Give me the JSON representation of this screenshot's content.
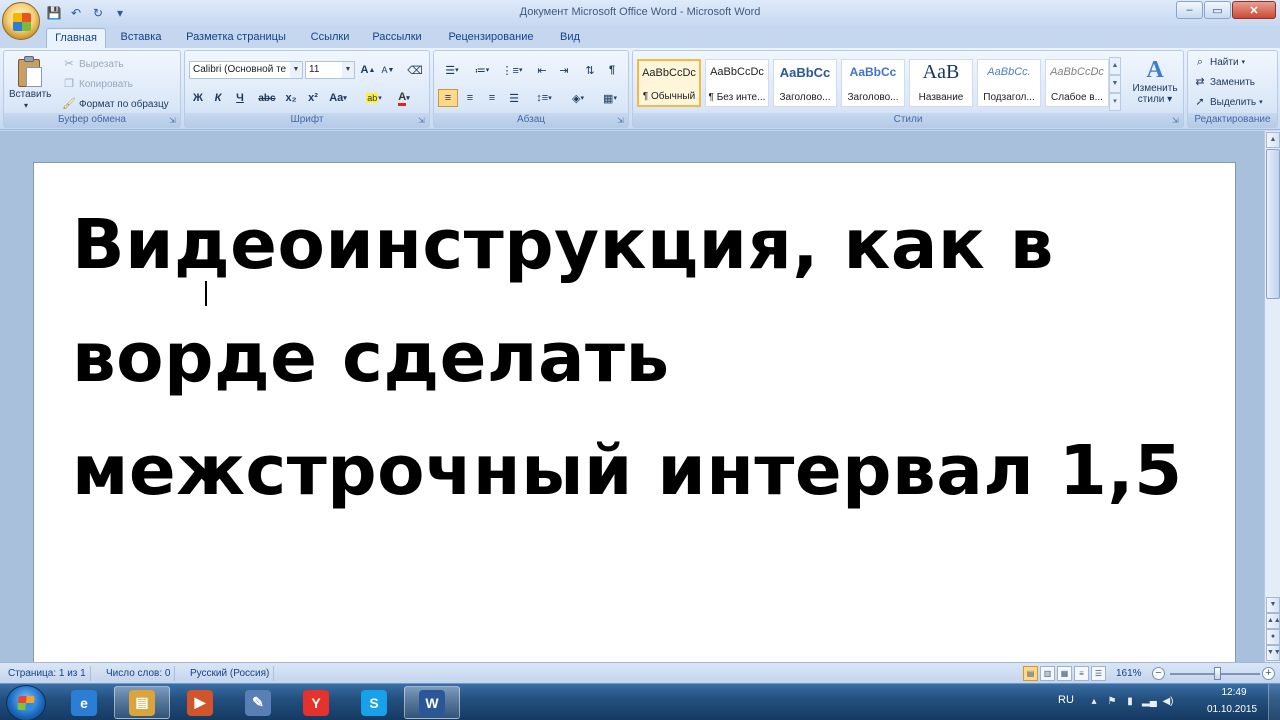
{
  "window": {
    "title": "Документ Microsoft Office Word - Microsoft Word",
    "controls": {
      "minimize": "–",
      "maximize": "▭",
      "close": "✕"
    }
  },
  "quick_access": {
    "save_icon": "💾",
    "undo_icon": "↶",
    "redo_icon": "↻",
    "customize_icon": "▾"
  },
  "tabs": [
    "Главная",
    "Вставка",
    "Разметка страницы",
    "Ссылки",
    "Рассылки",
    "Рецензирование",
    "Вид"
  ],
  "active_tab": "Главная",
  "ribbon": {
    "clipboard": {
      "label": "Буфер обмена",
      "paste": "Вставить",
      "cut": "Вырезать",
      "copy": "Копировать",
      "format_painter": "Формат по образцу"
    },
    "font": {
      "label": "Шрифт",
      "font_name": "Calibri (Основной те",
      "font_size": "11",
      "grow": "A",
      "shrink": "A",
      "clear": "⌫",
      "bold": "Ж",
      "italic": "К",
      "underline": "Ч",
      "strike": "abc",
      "subscript": "x₂",
      "superscript": "x²",
      "case": "Aa",
      "highlight": "ab",
      "color": "A"
    },
    "paragraph": {
      "label": "Абзац"
    },
    "styles": {
      "label": "Стили",
      "tiles": [
        {
          "sample": "AaBbCcDc",
          "name": "¶ Обычный",
          "active": true
        },
        {
          "sample": "AaBbCcDc",
          "name": "¶ Без инте..."
        },
        {
          "sample": "AaBbCc",
          "name": "Заголово..."
        },
        {
          "sample": "AaBbCc",
          "name": "Заголово..."
        },
        {
          "sample": "AaB",
          "name": "Название"
        },
        {
          "sample": "AaBbCc.",
          "name": "Подзагол..."
        },
        {
          "sample": "AaBbCcDc",
          "name": "Слабое в..."
        }
      ],
      "change_styles_line1": "Изменить",
      "change_styles_line2": "стили"
    },
    "editing": {
      "label": "Редактирование",
      "find": "Найти",
      "replace": "Заменить",
      "select": "Выделить"
    }
  },
  "document": {
    "heading": "Видеоинструкция, как в ворде сделать межстрочный интервал 1,5"
  },
  "statusbar": {
    "page": "Страница: 1 из 1",
    "words": "Число слов: 0",
    "language": "Русский (Россия)",
    "zoom": "161%",
    "zoom_level_percent": 161
  },
  "taskbar": {
    "apps": [
      {
        "name": "internet-explorer-icon",
        "glyph": "e",
        "color": "#2a7fd4"
      },
      {
        "name": "file-explorer-icon",
        "glyph": "▤",
        "color": "#d9a53c",
        "active": true
      },
      {
        "name": "media-player-icon",
        "glyph": "▶",
        "color": "#d1542a"
      },
      {
        "name": "paint-icon",
        "glyph": "✎",
        "color": "#5a7fb5"
      },
      {
        "name": "yandex-browser-icon",
        "glyph": "Y",
        "color": "#e5322d"
      },
      {
        "name": "skype-icon",
        "glyph": "S",
        "color": "#16a1e8"
      },
      {
        "name": "word-icon",
        "glyph": "W",
        "color": "#2b5797",
        "active": true
      }
    ],
    "language": "RU",
    "time": "12:49",
    "date": "01.10.2015"
  }
}
